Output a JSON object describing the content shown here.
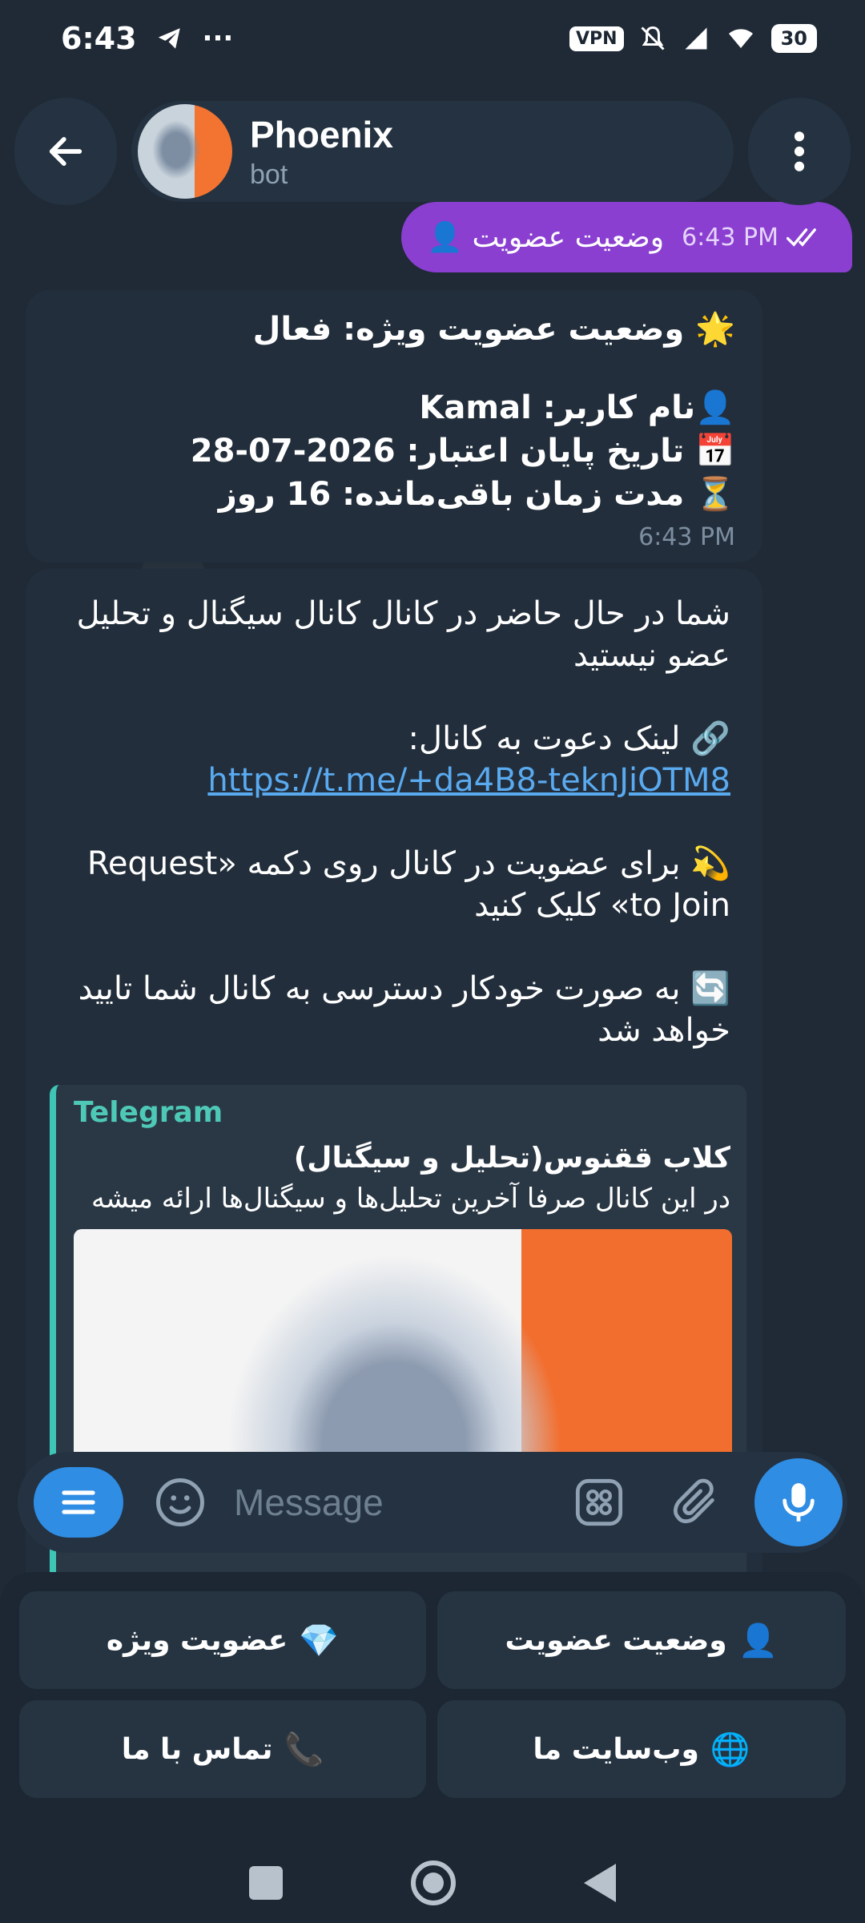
{
  "status_bar": {
    "time": "6:43",
    "vpn": "VPN",
    "battery": "30"
  },
  "header": {
    "chat_name": "Phoenix",
    "chat_subtitle": "bot"
  },
  "messages": {
    "outgoing": {
      "text": "وضعیت عضویت 👤",
      "time": "6:43 PM"
    },
    "status_card": {
      "line1": "🌟 وضعیت عضویت ویژه: فعال",
      "line2": "👤نام کاربر: Kamal",
      "line3": "📅 تاریخ پایان اعتبار: 2026-07-28",
      "line4": "⏳ مدت زمان باقی‌مانده: 16 روز",
      "time": "6:43 PM"
    },
    "invite_card": {
      "para1": "شما در حال حاضر در کانال کانال سیگنال و تحلیل عضو نیستید",
      "para2_prefix": "🔗 لینک دعوت به کانال: ",
      "para2_link": "https://t.me/+da4B8-teknJiOTM8",
      "para3": "💫 برای عضویت در کانال روی دکمه «Request to Join» کلیک کنید",
      "para4": "🔄 به صورت خودکار دسترسی به کانال شما تایید خواهد شد",
      "preview": {
        "site": "Telegram",
        "title": "کلاب ققنوس(تحلیل و سیگنال)",
        "description": "در این کانال صرفا آخرین تحلیل‌ها و سیگنال‌ها ارائه میشه"
      }
    }
  },
  "input": {
    "placeholder": "Message"
  },
  "keyboard": {
    "buttons": [
      {
        "emoji": "👤",
        "label": "وضعیت عضویت"
      },
      {
        "emoji": "💎",
        "label": "عضویت ویژه"
      },
      {
        "emoji": "🌐",
        "label": "وب‌سایت ما"
      },
      {
        "emoji": "📞",
        "label": "تماس با ما"
      }
    ]
  },
  "colors": {
    "background": "#1c2733",
    "outgoing_bubble": "#8a3fd1",
    "incoming_bubble": "#222e3b",
    "accent": "#2f8de4",
    "link": "#5aaaf0",
    "preview_accent": "#3fc5b5"
  }
}
